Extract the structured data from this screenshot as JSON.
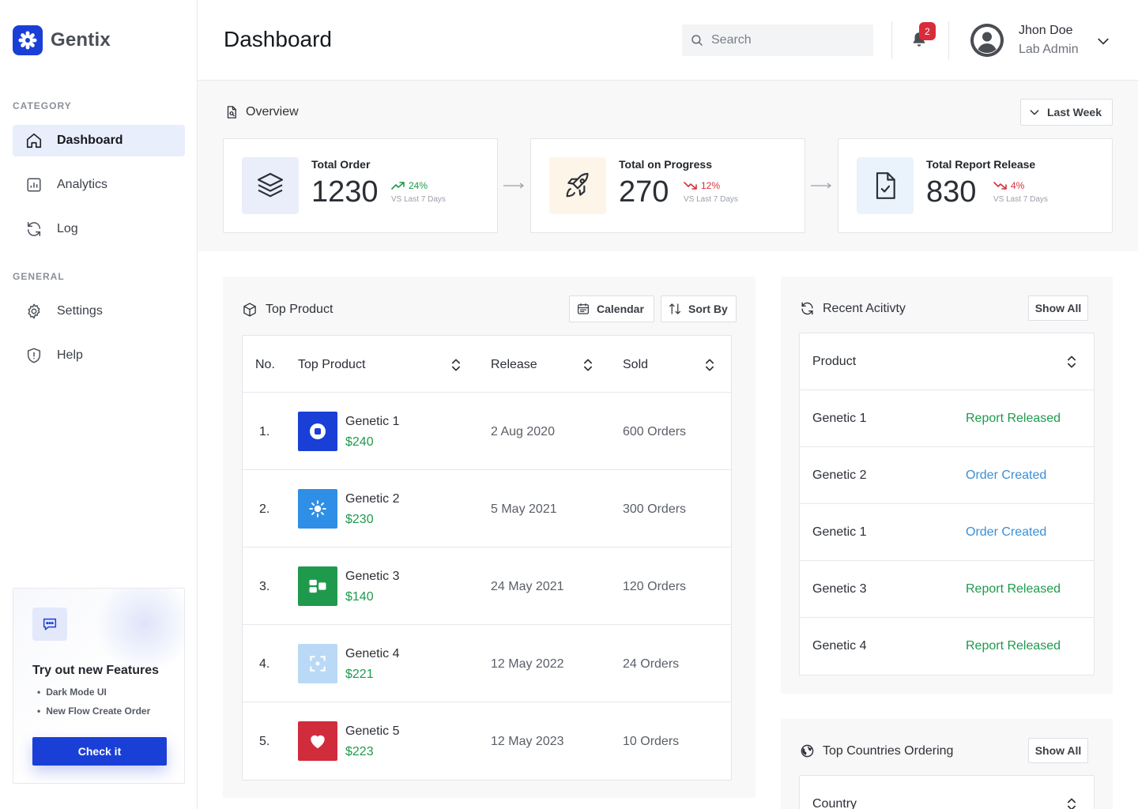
{
  "brand": {
    "name": "Gentix",
    "accent": "#1a3fd7"
  },
  "sidebar": {
    "category_label": "CATEGORY",
    "general_label": "GENERAL",
    "category_items": [
      {
        "label": "Dashboard",
        "icon": "home-icon",
        "active": true
      },
      {
        "label": "Analytics",
        "icon": "bar-chart-icon",
        "active": false
      },
      {
        "label": "Log",
        "icon": "refresh-icon",
        "active": false
      }
    ],
    "general_items": [
      {
        "label": "Settings",
        "icon": "gear-icon"
      },
      {
        "label": "Help",
        "icon": "shield-alert-icon"
      }
    ],
    "promo": {
      "title": "Try out new Features",
      "features": [
        "Dark Mode UI",
        "New Flow Create Order"
      ],
      "button_label": "Check it"
    }
  },
  "header": {
    "title": "Dashboard",
    "search_placeholder": "Search",
    "notification_count": "2",
    "user": {
      "name": "Jhon Doe",
      "role": "Lab Admin"
    }
  },
  "overview": {
    "title": "Overview",
    "range_label": "Last Week",
    "stats": [
      {
        "label": "Total Order",
        "value": "1230",
        "trend": "24%",
        "direction": "up",
        "sub": "VS Last 7 Days",
        "icon": "layers-icon",
        "icon_bg": "#eaeefb"
      },
      {
        "label": "Total on Progress",
        "value": "270",
        "trend": "12%",
        "direction": "down",
        "sub": "VS Last 7 Days",
        "icon": "rocket-icon",
        "icon_bg": "#fdf5e8"
      },
      {
        "label": "Total Report Release",
        "value": "830",
        "trend": "4%",
        "direction": "down",
        "sub": "VS Last 7 Days",
        "icon": "file-check-icon",
        "icon_bg": "#eaf3fc"
      }
    ]
  },
  "top_product": {
    "title": "Top Product",
    "calendar_label": "Calendar",
    "sort_label": "Sort By",
    "columns": [
      "No.",
      "Top Product",
      "Release",
      "Sold"
    ],
    "rows": [
      {
        "no": "1.",
        "name": "Genetic 1",
        "price": "$240",
        "release": "2 Aug 2020",
        "sold": "600 Orders",
        "thumb": "#1a3fd7",
        "icon": "circle-stop-icon"
      },
      {
        "no": "2.",
        "name": "Genetic 2",
        "price": "$230",
        "release": "5 May 2021",
        "sold": "300 Orders",
        "thumb": "#2f8fe6",
        "icon": "sun-icon"
      },
      {
        "no": "3.",
        "name": "Genetic 3",
        "price": "$140",
        "release": "24 May 2021",
        "sold": "120 Orders",
        "thumb": "#1f9a4d",
        "icon": "blocks-icon"
      },
      {
        "no": "4.",
        "name": "Genetic 4",
        "price": "$221",
        "release": "12 May 2022",
        "sold": "24 Orders",
        "thumb": "#b9d9f6",
        "icon": "scan-icon"
      },
      {
        "no": "5.",
        "name": "Genetic 5",
        "price": "$223",
        "release": "12 May 2023",
        "sold": "10 Orders",
        "thumb": "#d12c3c",
        "icon": "heart-icon"
      }
    ]
  },
  "recent_activity": {
    "title": "Recent Acitivty",
    "show_all": "Show All",
    "column": "Product",
    "rows": [
      {
        "product": "Genetic 1",
        "status": "Report Released",
        "tone": "green"
      },
      {
        "product": "Genetic 2",
        "status": "Order Created",
        "tone": "blue"
      },
      {
        "product": "Genetic 1",
        "status": "Order Created",
        "tone": "blue"
      },
      {
        "product": "Genetic 3",
        "status": "Report Released",
        "tone": "green"
      },
      {
        "product": "Genetic 4",
        "status": "Report Released",
        "tone": "green"
      }
    ]
  },
  "top_countries": {
    "title": "Top Countries Ordering",
    "show_all": "Show All",
    "column": "Country"
  }
}
